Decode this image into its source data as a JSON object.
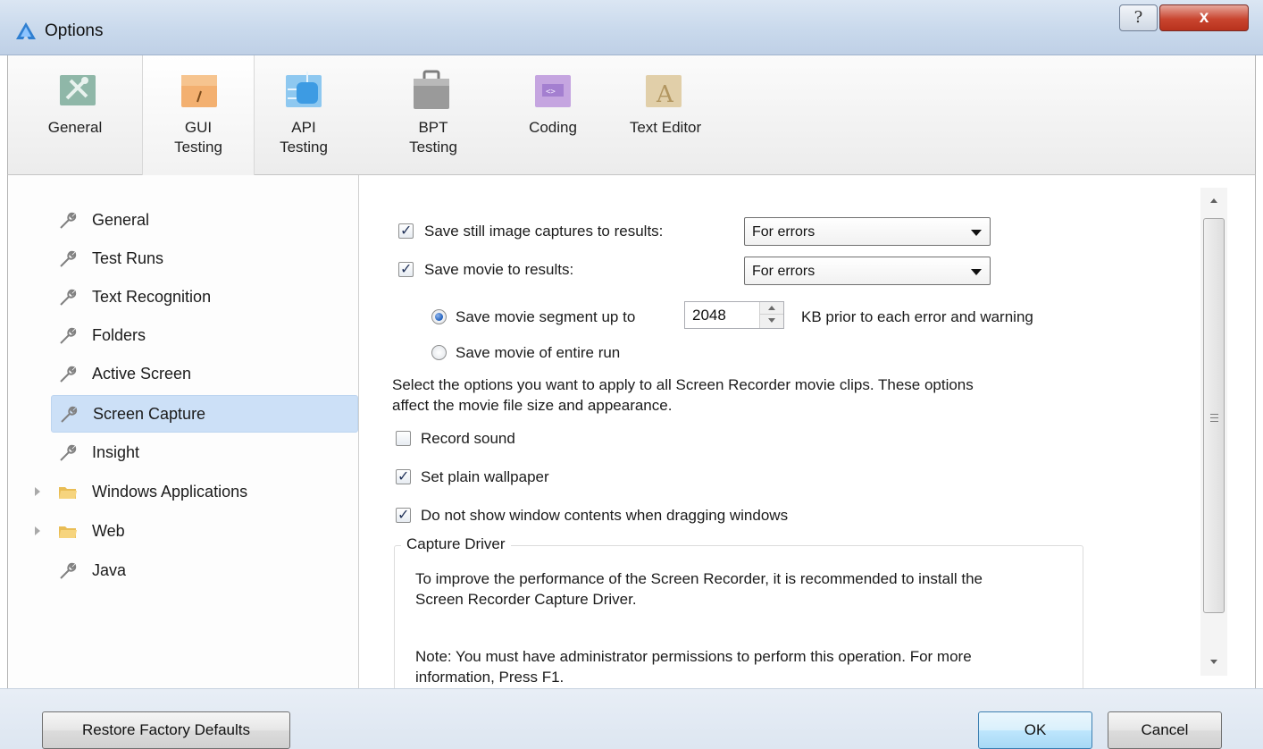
{
  "window": {
    "title": "Options",
    "help_glyph": "?",
    "close_glyph": "x"
  },
  "categories": [
    {
      "label": "General",
      "icon": "general-tools-icon"
    },
    {
      "label": "GUI\nTesting",
      "icon": "gui-testing-icon"
    },
    {
      "label": "API\nTesting",
      "icon": "api-testing-icon"
    },
    {
      "label": "BPT\nTesting",
      "icon": "bpt-testing-icon"
    },
    {
      "label": "Coding",
      "icon": "coding-icon"
    },
    {
      "label": "Text Editor",
      "icon": "text-editor-icon"
    }
  ],
  "active_category": "GUI Testing",
  "tree": {
    "items": [
      {
        "label": "General",
        "icon": "wrench-icon"
      },
      {
        "label": "Test Runs",
        "icon": "wrench-icon"
      },
      {
        "label": "Text Recognition",
        "icon": "wrench-icon"
      },
      {
        "label": "Folders",
        "icon": "wrench-icon"
      },
      {
        "label": "Active Screen",
        "icon": "wrench-icon"
      },
      {
        "label": "Screen Capture",
        "icon": "wrench-icon"
      },
      {
        "label": "Insight",
        "icon": "wrench-icon"
      },
      {
        "label": "Windows Applications",
        "icon": "folder-icon"
      },
      {
        "label": "Web",
        "icon": "folder-icon"
      },
      {
        "label": "Java",
        "icon": "wrench-icon"
      }
    ],
    "selected": "Screen Capture"
  },
  "settings": {
    "save_still": {
      "label": "Save still image captures to results:",
      "checked": true,
      "value": "For errors"
    },
    "save_movie": {
      "label": "Save movie to results:",
      "checked": true,
      "value": "For errors"
    },
    "segment_radio": {
      "label": "Save movie segment up to",
      "checked": true,
      "value": "2048",
      "suffix": "KB prior to each error and warning"
    },
    "entire_radio": {
      "label": "Save movie of entire run",
      "checked": false
    },
    "description_line1": "Select the options you want to apply to all Screen Recorder movie clips. These options",
    "description_line2": "affect the movie file size and appearance.",
    "record_sound": {
      "label": "Record sound",
      "checked": false
    },
    "plain_wallpaper": {
      "label": "Set plain wallpaper",
      "checked": true
    },
    "no_window_contents": {
      "label": "Do not show window contents when dragging windows",
      "checked": true
    },
    "capture_driver": {
      "legend": "Capture Driver",
      "line1": "To improve the performance of the Screen Recorder, it is recommended to install the",
      "line2": "Screen Recorder Capture Driver.",
      "note1": "Note: You must have administrator permissions to perform this operation. For more",
      "note2": "information, Press F1."
    }
  },
  "buttons": {
    "restore": "Restore Factory Defaults",
    "ok": "OK",
    "cancel": "Cancel"
  },
  "colors": {
    "selection": "#cce0f7",
    "close_button": "#c9452f",
    "default_button_border": "#3c7fb1"
  }
}
